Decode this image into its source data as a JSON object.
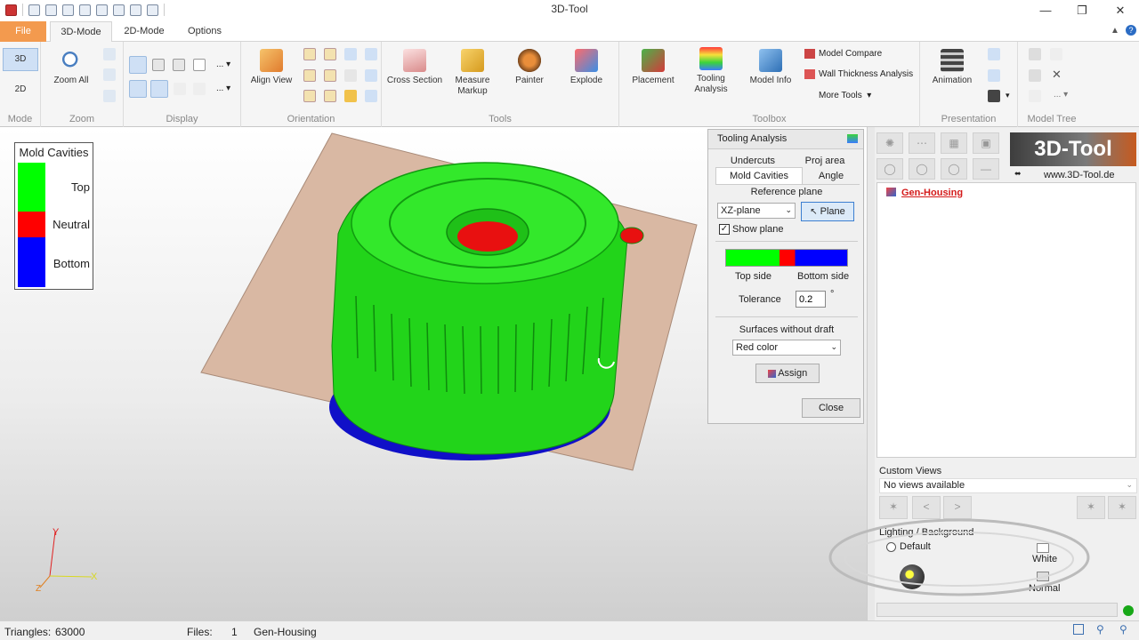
{
  "window": {
    "title": "3D-Tool"
  },
  "tabs": [
    "File",
    "3D-Mode",
    "2D-Mode",
    "Options"
  ],
  "ribbon": {
    "mode": {
      "label": "Mode",
      "btn3d": "3D",
      "btn2d": "2D"
    },
    "zoom": {
      "label": "Zoom",
      "zoom_all": "Zoom All"
    },
    "display": {
      "label": "Display",
      "more": "..."
    },
    "orientation": {
      "label": "Orientation",
      "align_view": "Align View"
    },
    "tools": {
      "label": "Tools",
      "items": [
        "Cross Section",
        "Measure Markup",
        "Painter",
        "Explode"
      ]
    },
    "toolbox": {
      "label": "Toolbox",
      "placement": "Placement",
      "tooling": "Tooling Analysis",
      "model_info": "Model Info",
      "model_compare": "Model Compare",
      "wall_thickness": "Wall Thickness Analysis",
      "more_tools": "More Tools"
    },
    "presentation": {
      "label": "Presentation",
      "animation": "Animation"
    },
    "model_tree": {
      "label": "Model Tree"
    }
  },
  "legend": {
    "title": "Mold Cavities",
    "items": [
      {
        "label": "Top",
        "color": "#00ff00"
      },
      {
        "label": "Neutral",
        "color": "#ff0000"
      },
      {
        "label": "Bottom",
        "color": "#0000ff"
      }
    ]
  },
  "dialog": {
    "title": "Tooling Analysis",
    "tabs": [
      "Undercuts",
      "Proj area",
      "Mold Cavities",
      "Angle"
    ],
    "reference_plane_label": "Reference plane",
    "plane_select": "XZ-plane",
    "plane_button": "Plane",
    "show_plane": "Show plane",
    "top_side": "Top side",
    "bottom_side": "Bottom side",
    "tolerance_label": "Tolerance",
    "tolerance_value": "0.2",
    "degree": "°",
    "surfaces_label": "Surfaces without draft",
    "surfaces_select": "Red color",
    "assign": "Assign",
    "close": "Close"
  },
  "right_panel": {
    "logo": "3D-Tool",
    "website": "www.3D-Tool.de",
    "tree_item": "Gen-Housing",
    "custom_views_label": "Custom Views",
    "custom_views_value": "No views available",
    "lighting_label": "Lighting / Background",
    "default": "Default",
    "white": "White",
    "normal": "Normal"
  },
  "axes": {
    "y": "Y",
    "x": "X",
    "z": "Z"
  },
  "status": {
    "triangles_label": "Triangles:",
    "triangles": "63000",
    "files_label": "Files:",
    "files": "1",
    "file_name": "Gen-Housing"
  },
  "colors": {
    "top": "#00ff00",
    "neutral": "#ff0000",
    "bottom": "#0000ff",
    "file_tab": "#f39a4e",
    "plane": "#d9b8a3"
  }
}
